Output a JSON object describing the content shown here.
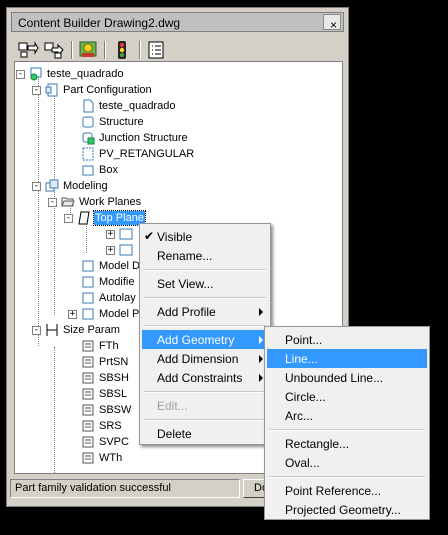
{
  "window": {
    "title": "Content Builder Drawing2.dwg",
    "close_glyph": "×"
  },
  "toolbar": {
    "buttons": [
      {
        "icon": "insert-icon"
      },
      {
        "icon": "extract-icon"
      },
      {
        "icon": "properties-icon"
      },
      {
        "icon": "traffic-light-icon"
      },
      {
        "icon": "list-icon"
      }
    ]
  },
  "tree": {
    "root": "teste_quadrado",
    "part_configuration": "Part Configuration",
    "pc_items": [
      "teste_quadrado",
      "Structure",
      "Junction Structure",
      "PV_RETANGULAR",
      "Box"
    ],
    "modeling": "Modeling",
    "work_planes": "Work Planes",
    "top_plane": "Top Plane",
    "model_items": [
      "Model D",
      "Modifie",
      "Autolay",
      "Model P"
    ],
    "size_params": "Size Param",
    "param_items": [
      "FTh",
      "PrtSN",
      "SBSH",
      "SBSL",
      "SBSW",
      "SRS",
      "SVPC",
      "WTh"
    ]
  },
  "statusbar": {
    "text": "Part family validation successful",
    "button_label": "Do"
  },
  "context_menu": {
    "items": [
      {
        "label": "Visible",
        "checked": true
      },
      {
        "label": "Rename..."
      },
      {
        "label": "Set View..."
      },
      {
        "label": "Add Profile"
      },
      {
        "label": "Add Geometry"
      },
      {
        "label": "Add Dimension"
      },
      {
        "label": "Add Constraints"
      },
      {
        "label": "Edit..."
      },
      {
        "label": "Delete"
      }
    ],
    "check_glyph": "✔"
  },
  "geometry_submenu": {
    "items": [
      "Point...",
      "Line...",
      "Unbounded Line...",
      "Circle...",
      "Arc...",
      "Rectangle...",
      "Oval...",
      "Point Reference...",
      "Projected Geometry..."
    ]
  },
  "colors": {
    "selection": "#3399ff",
    "window_bg": "#d4d0c8",
    "menu_bg": "#f0f0f0"
  }
}
